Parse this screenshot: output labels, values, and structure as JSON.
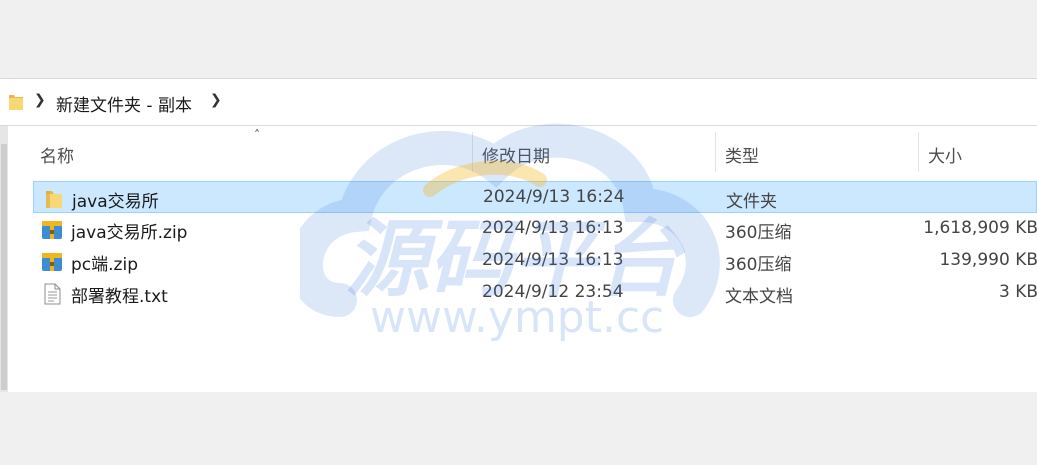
{
  "address_bar": {
    "path": "新建文件夹 - 副本"
  },
  "columns": {
    "name": "名称",
    "date": "修改日期",
    "type": "类型",
    "size": "大小"
  },
  "files": [
    {
      "name": "java交易所",
      "date": "2024/9/13 16:24",
      "type": "文件夹",
      "size": "",
      "icon": "folder-icon",
      "selected": true
    },
    {
      "name": "java交易所.zip",
      "date": "2024/9/13 16:13",
      "type": "360压缩",
      "size": "1,618,909 KB",
      "icon": "zip-archive-icon",
      "selected": false
    },
    {
      "name": "pc端.zip",
      "date": "2024/9/13 16:13",
      "type": "360压缩",
      "size": "139,990 KB",
      "icon": "zip-archive-icon",
      "selected": false
    },
    {
      "name": "部署教程.txt",
      "date": "2024/9/12 23:54",
      "type": "文本文档",
      "size": "3 KB",
      "icon": "text-document-icon",
      "selected": false
    }
  ],
  "watermark": {
    "title": "源码平台",
    "url": "www.ympt.cc"
  },
  "colors": {
    "selection_bg": "#cce8ff",
    "selection_border": "#99d1ff",
    "folder_yellow": "#f8d775",
    "watermark_blue": "#3c78d8"
  }
}
